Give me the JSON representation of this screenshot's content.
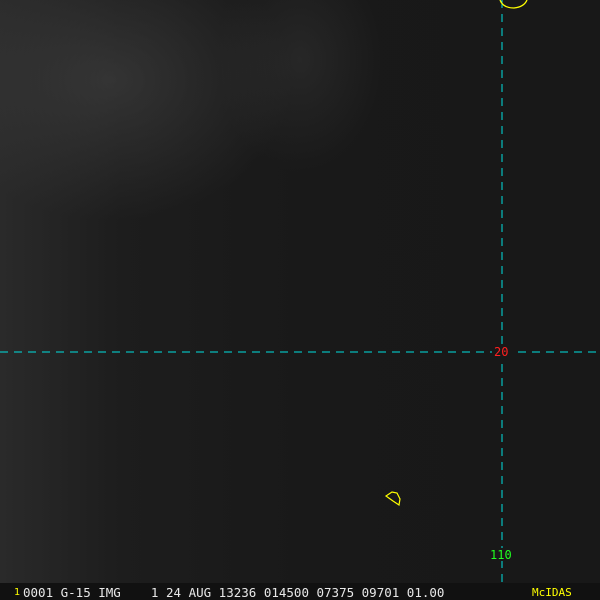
{
  "grid": {
    "lat_label": "20",
    "lon_label": "110",
    "line_color": "#00e0e0",
    "lat_label_color": "#ff2020",
    "lon_label_color": "#20ff20"
  },
  "coastline_color": "#ffff00",
  "footer": {
    "frame_number": "1",
    "info": "0001 G-15 IMG    1 24 AUG 13236 014500 07375 09701 01.00",
    "brand": "McIDAS",
    "text_color": "#e8e8e8",
    "accent_color": "#ffff00"
  }
}
